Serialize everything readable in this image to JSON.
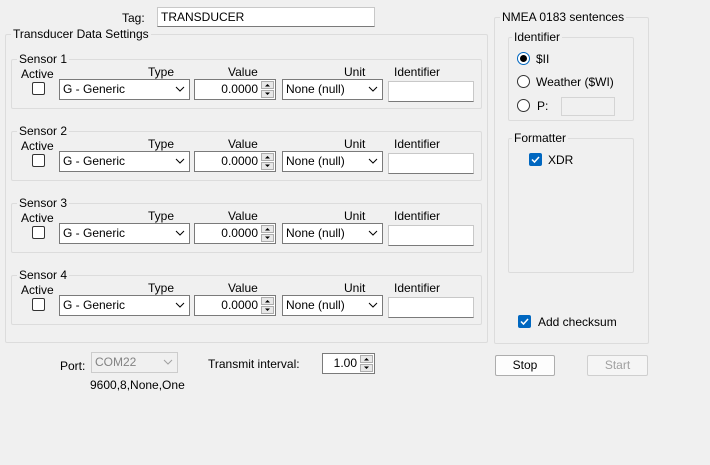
{
  "tag": {
    "label": "Tag:",
    "value": "TRANSDUCER"
  },
  "transducer_group": {
    "title": "Transducer Data Settings",
    "headers": {
      "active": "Active",
      "type": "Type",
      "value": "Value",
      "unit": "Unit",
      "identifier": "Identifier"
    },
    "sensors": [
      {
        "title": "Sensor 1",
        "active": false,
        "type": "G - Generic",
        "value": "0.0000",
        "unit": "None (null)",
        "identifier": ""
      },
      {
        "title": "Sensor 2",
        "active": false,
        "type": "G - Generic",
        "value": "0.0000",
        "unit": "None (null)",
        "identifier": ""
      },
      {
        "title": "Sensor 3",
        "active": false,
        "type": "G - Generic",
        "value": "0.0000",
        "unit": "None (null)",
        "identifier": ""
      },
      {
        "title": "Sensor 4",
        "active": false,
        "type": "G - Generic",
        "value": "0.0000",
        "unit": "None (null)",
        "identifier": ""
      }
    ]
  },
  "nmea_group": {
    "title": "NMEA 0183 sentences",
    "identifier": {
      "title": "Identifier",
      "options": [
        {
          "label": "$II",
          "selected": true
        },
        {
          "label": "Weather ($WI)",
          "selected": false
        },
        {
          "label": "P:",
          "selected": false
        }
      ],
      "p_value": ""
    },
    "formatter": {
      "title": "Formatter",
      "xdr_label": "XDR",
      "xdr_checked": true
    },
    "add_checksum_label": "Add checksum",
    "add_checksum_checked": true
  },
  "port": {
    "label": "Port:",
    "value": "COM22",
    "settings": "9600,8,None,One"
  },
  "transmit": {
    "label": "Transmit interval:",
    "value": "1.00"
  },
  "buttons": {
    "stop": "Stop",
    "start": "Start"
  },
  "colors": {
    "accent": "#0067c0",
    "background": "#f0f0f0",
    "border": "#dcdcdc"
  }
}
